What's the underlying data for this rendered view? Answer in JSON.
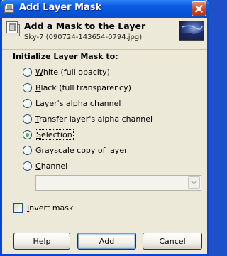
{
  "window": {
    "title": "Add Layer Mask",
    "icons": {
      "app": "mask-app-icon",
      "close": "close-icon"
    }
  },
  "header": {
    "title": "Add a Mask to the Layer",
    "subtitle": "Sky-7 (090724-143654-0794.jpg)",
    "icons": {
      "left": "layer-mask-icon",
      "right": "layer-thumbnail"
    }
  },
  "init": {
    "label": "Initialize Layer Mask to:",
    "options": [
      {
        "pre": "",
        "key": "W",
        "post": "hite (full opacity)"
      },
      {
        "pre": "",
        "key": "B",
        "post": "lack (full transparency)"
      },
      {
        "pre": "Layer's ",
        "key": "a",
        "post": "lpha channel"
      },
      {
        "pre": "",
        "key": "T",
        "post": "ransfer layer's alpha channel"
      },
      {
        "pre": "",
        "key": "S",
        "post": "election"
      },
      {
        "pre": "",
        "key": "G",
        "post": "rayscale copy of layer"
      },
      {
        "pre": "",
        "key": "C",
        "post": "hannel"
      }
    ],
    "selected_index": 4,
    "channel_select": {
      "value": "",
      "disabled": true,
      "icon": "chevron-down-icon"
    }
  },
  "invert": {
    "pre": "",
    "key": "I",
    "post": "nvert mask",
    "checked": false
  },
  "buttons": {
    "help": {
      "key": "H",
      "post": "elp"
    },
    "add": {
      "key": "A",
      "post": "dd"
    },
    "cancel": {
      "key": "C",
      "post": "ancel"
    }
  },
  "colors": {
    "title_bar": "#0a56d8",
    "window_border": "#0a46d6",
    "dialog_bg": "#ece9d8",
    "close_button": "#c4401f",
    "selected_radio": "#2a9a2a"
  }
}
